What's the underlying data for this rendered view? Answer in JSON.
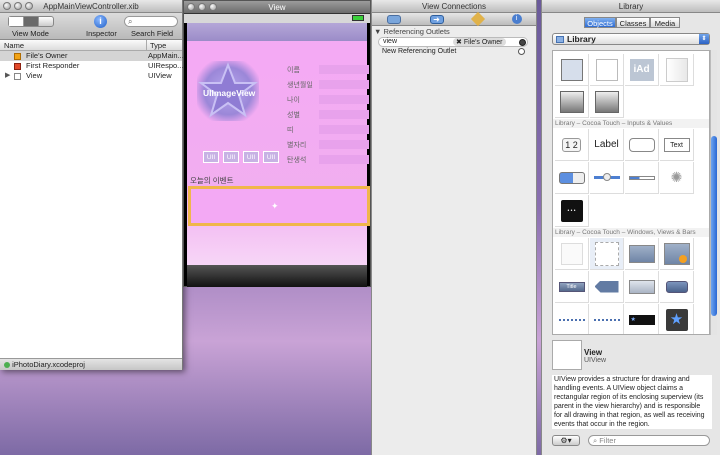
{
  "left_window": {
    "title": "AppMainViewController.xib",
    "toolbar": {
      "view_mode": "View Mode",
      "inspector": "Inspector",
      "search_field": "Search Field"
    },
    "columns": {
      "name": "Name",
      "type": "Type"
    },
    "rows": [
      {
        "name": "File's Owner",
        "type": "AppMain..."
      },
      {
        "name": "First Responder",
        "type": "UIRespo..."
      },
      {
        "name": "View",
        "type": "UIView"
      }
    ],
    "status": "iPhotoDiary.xcodeproj"
  },
  "view_window": {
    "title": "View",
    "image_label": "UIImageView",
    "fields": [
      "이름",
      "생년월일",
      "나이",
      "성별",
      "띠",
      "별자리",
      "탄생석"
    ],
    "small_buttons": [
      "UII",
      "UII",
      "UII",
      "UII"
    ],
    "event_label": "오늘의 이벤트"
  },
  "connections_window": {
    "title": "View Connections",
    "section": "Referencing Outlets",
    "outlet_name": "view",
    "outlet_target": "File's Owner",
    "new_outlet": "New Referencing Outlet"
  },
  "library_window": {
    "title": "Library",
    "tabs": [
      "Objects",
      "Classes",
      "Media"
    ],
    "popup": "Library",
    "sections": {
      "inputs": "Library – Cocoa Touch – Inputs & Values",
      "windows": "Library – Cocoa Touch – Windows, Views & Bars"
    },
    "controls": {
      "seg": "1 2",
      "label": "Label",
      "text": "Text",
      "iad": "iAd",
      "title": "Title"
    },
    "detail_title": "View",
    "detail_subtitle": "UIView",
    "detail_desc": "UIView provides a structure for drawing and handling events. A UIView object claims a rectangular region of its enclosing superview (its parent in the view hierarchy) and is responsible for all drawing in that region, as well as receiving events that occur in the region.",
    "filter_placeholder": "Filter"
  }
}
